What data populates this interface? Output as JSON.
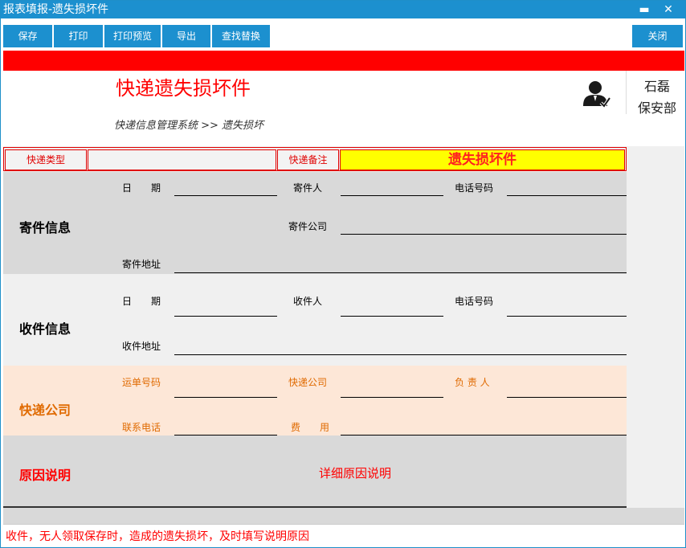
{
  "window": {
    "title": "报表填报-遗失损坏件",
    "minimize": "▬",
    "close": "✕"
  },
  "toolbar": {
    "save": "保存",
    "print": "打印",
    "print_preview": "打印预览",
    "export": "导出",
    "find_replace": "查找替换",
    "close": "关闭"
  },
  "header": {
    "title": "快递遗失损坏件",
    "breadcrumb": "快递信息管理系统 >> 遗失损坏",
    "user_name": "石磊",
    "user_dept": "保安部"
  },
  "type_row": {
    "type_label": "快递类型",
    "type_value": "",
    "note_label": "快递备注",
    "note_value": "遗失损坏件"
  },
  "sender": {
    "title": "寄件信息",
    "date": "日　　期",
    "person": "寄件人",
    "phone": "电话号码",
    "company": "寄件公司",
    "address": "寄件地址"
  },
  "receiver": {
    "title": "收件信息",
    "date": "日　　期",
    "person": "收件人",
    "phone": "电话号码",
    "address": "收件地址"
  },
  "express": {
    "title": "快递公司",
    "waybill": "运单号码",
    "company": "快递公司",
    "manager": "负 责 人",
    "contact": "联系电话",
    "fee": "费　　用"
  },
  "reason": {
    "title": "原因说明",
    "placeholder": "详细原因说明"
  },
  "status": "收件，无人领取保存时，造成的遗失损坏，及时填写说明原因",
  "colors": {
    "accent": "#1c90cf",
    "red": "#ff0000",
    "highlight": "#ffff00",
    "orange": "#e06a00"
  },
  "icons": {
    "user": "user-avatar-icon"
  }
}
